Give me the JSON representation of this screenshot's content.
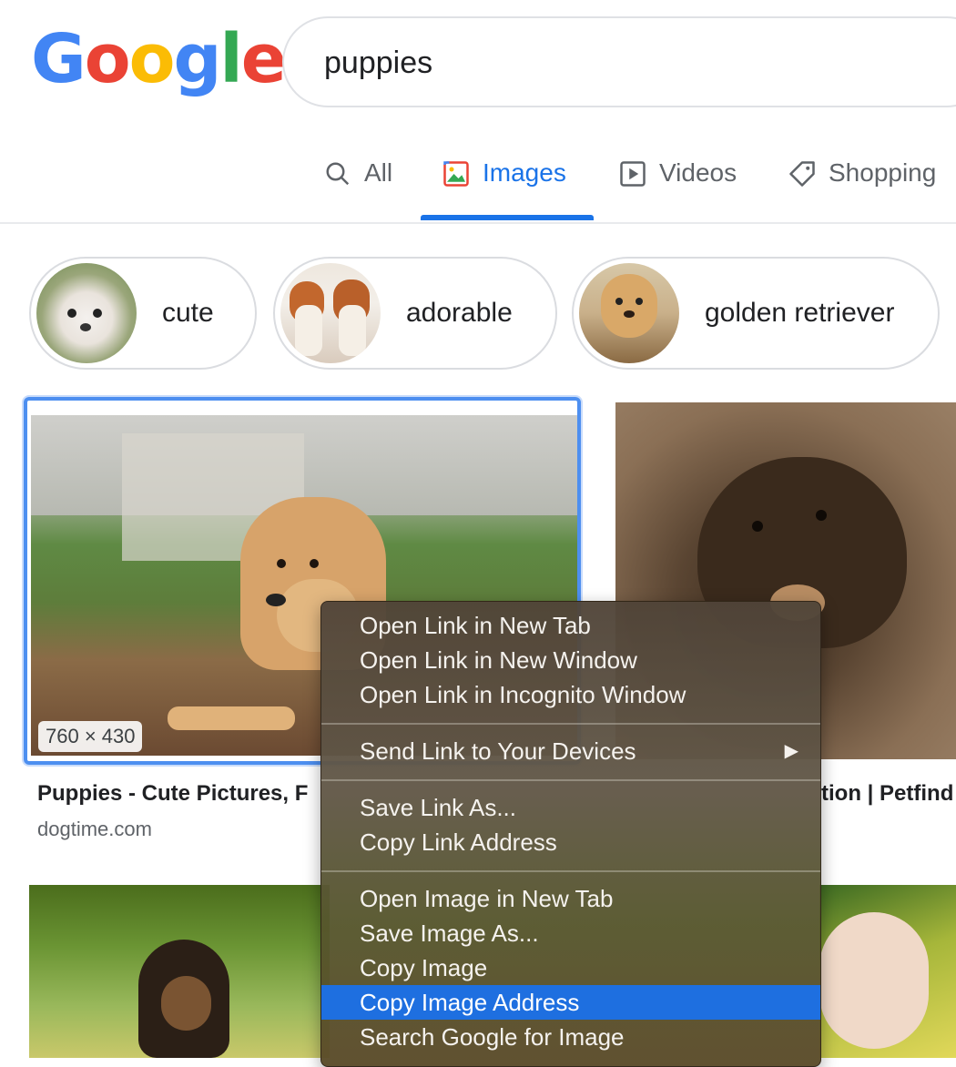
{
  "logo": {
    "letters": [
      "G",
      "o",
      "o",
      "g",
      "l",
      "e"
    ],
    "colors": [
      "#4285f4",
      "#ea4335",
      "#fbbc05",
      "#4285f4",
      "#34a853",
      "#ea4335"
    ]
  },
  "search": {
    "value": "puppies"
  },
  "tabs": [
    {
      "label": "All",
      "icon": "search-icon",
      "active": false
    },
    {
      "label": "Images",
      "icon": "image-icon",
      "active": true
    },
    {
      "label": "Videos",
      "icon": "video-icon",
      "active": false
    },
    {
      "label": "Shopping",
      "icon": "tag-icon",
      "active": false
    }
  ],
  "chips": [
    {
      "label": "cute"
    },
    {
      "label": "adorable"
    },
    {
      "label": "golden retriever"
    }
  ],
  "results": [
    {
      "title": "Puppies - Cute Pictures, F",
      "site": "dogtime.com",
      "dimensions": "760 × 430"
    },
    {
      "title": "tion | Petfind"
    }
  ],
  "context_menu": {
    "items": [
      {
        "label": "Open Link in New Tab"
      },
      {
        "label": "Open Link in New Window"
      },
      {
        "label": "Open Link in Incognito Window"
      },
      {
        "label": "Send Link to Your Devices",
        "submenu_arrow": "▶"
      },
      {
        "label": "Save Link As..."
      },
      {
        "label": "Copy Link Address"
      },
      {
        "label": "Open Image in New Tab"
      },
      {
        "label": "Save Image As..."
      },
      {
        "label": "Copy Image"
      },
      {
        "label": "Copy Image Address",
        "highlighted": true
      },
      {
        "label": "Search Google for Image"
      }
    ]
  },
  "colors": {
    "accent": "#1a73e8",
    "highlight": "#1e6fe0",
    "selection_border": "#4d8ff0"
  }
}
